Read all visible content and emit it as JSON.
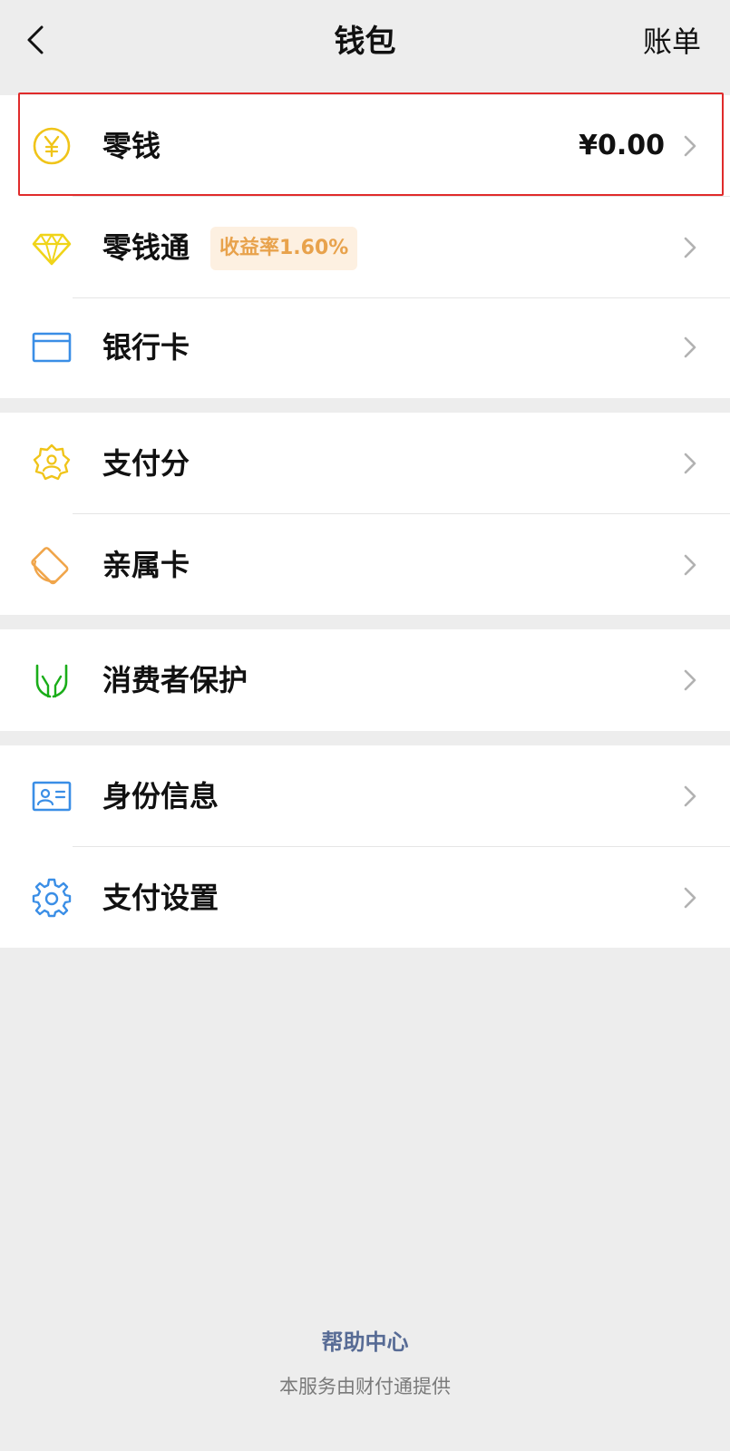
{
  "header": {
    "title": "钱包",
    "bill_label": "账单"
  },
  "sections": [
    {
      "items": [
        {
          "label": "零钱",
          "value": "¥0.00",
          "icon": "coin-yen-icon"
        },
        {
          "label": "零钱通",
          "badge": "收益率1.60%",
          "icon": "diamond-icon"
        },
        {
          "label": "银行卡",
          "icon": "bank-card-icon"
        }
      ]
    },
    {
      "items": [
        {
          "label": "支付分",
          "icon": "credit-score-badge-icon"
        },
        {
          "label": "亲属卡",
          "icon": "family-card-icon"
        }
      ]
    },
    {
      "items": [
        {
          "label": "消费者保护",
          "icon": "protect-hands-icon"
        }
      ]
    },
    {
      "items": [
        {
          "label": "身份信息",
          "icon": "id-card-icon"
        },
        {
          "label": "支付设置",
          "icon": "gear-icon"
        }
      ]
    }
  ],
  "footer": {
    "help_center": "帮助中心",
    "provider": "本服务由财付通提供"
  },
  "colors": {
    "background": "#ededed",
    "highlight_border": "#e02b2b",
    "link_blue": "#576b95",
    "badge_text": "#e8a24c",
    "badge_bg": "#fdf0e1"
  }
}
